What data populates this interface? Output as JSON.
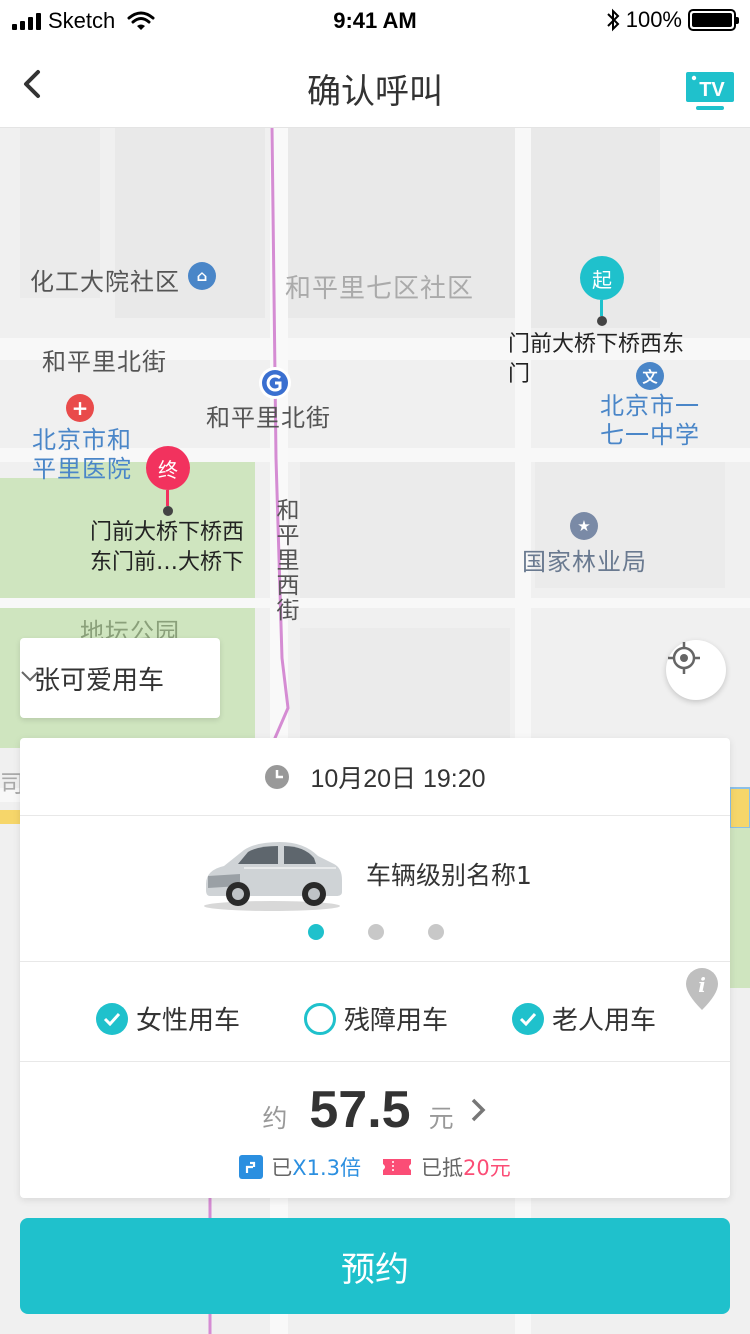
{
  "status_bar": {
    "carrier": "Sketch",
    "time": "9:41 AM",
    "battery": "100%"
  },
  "nav": {
    "title": "确认呼叫",
    "right_badge": "TV"
  },
  "map": {
    "labels": {
      "chemical_community": "化工大院社区",
      "heping_7_community": "和平里七区社区",
      "heping_north_st_1": "和平里北街",
      "heping_north_st_2": "和平里北街",
      "heping_hospital": "北京市和\n平里医院",
      "school_171": "北京市一\n七一中学",
      "forestry_bureau": "国家林业局",
      "heping_west_st": "和平里西街",
      "ditan_park": "地坛公园",
      "edge_partial": "司"
    },
    "start_marker": {
      "badge": "起",
      "label": "门前大桥下桥西东\n门"
    },
    "end_marker": {
      "badge": "终",
      "label": "门前大桥下桥西\n东门前…大桥下"
    },
    "poi_icons": {
      "school": "文",
      "hospital": "+"
    }
  },
  "rider_select": {
    "label": "张可爱用车"
  },
  "order_card": {
    "time": "10月20日 19:20",
    "vehicle_level": "车辆级别名称1",
    "carousel_dots": 3,
    "carousel_active_index": 0,
    "options": [
      {
        "label": "女性用车",
        "checked": true
      },
      {
        "label": "残障用车",
        "checked": false
      },
      {
        "label": "老人用车",
        "checked": true
      }
    ],
    "price": {
      "prefix": "约",
      "value": "57.5",
      "unit": "元",
      "surge_prefix": "已",
      "surge_value": "X1.3倍",
      "coupon_prefix": "已抵",
      "coupon_value": "20元"
    }
  },
  "book_button": {
    "label": "预约"
  },
  "colors": {
    "accent": "#1fc1cc",
    "end_marker": "#f2325e",
    "surge": "#2b8fe0",
    "coupon": "#fb4d76"
  },
  "icons": [
    "back-icon",
    "tv-icon",
    "locate-icon",
    "clock-icon",
    "info-icon",
    "chevron-down-icon",
    "chevron-right-icon"
  ]
}
